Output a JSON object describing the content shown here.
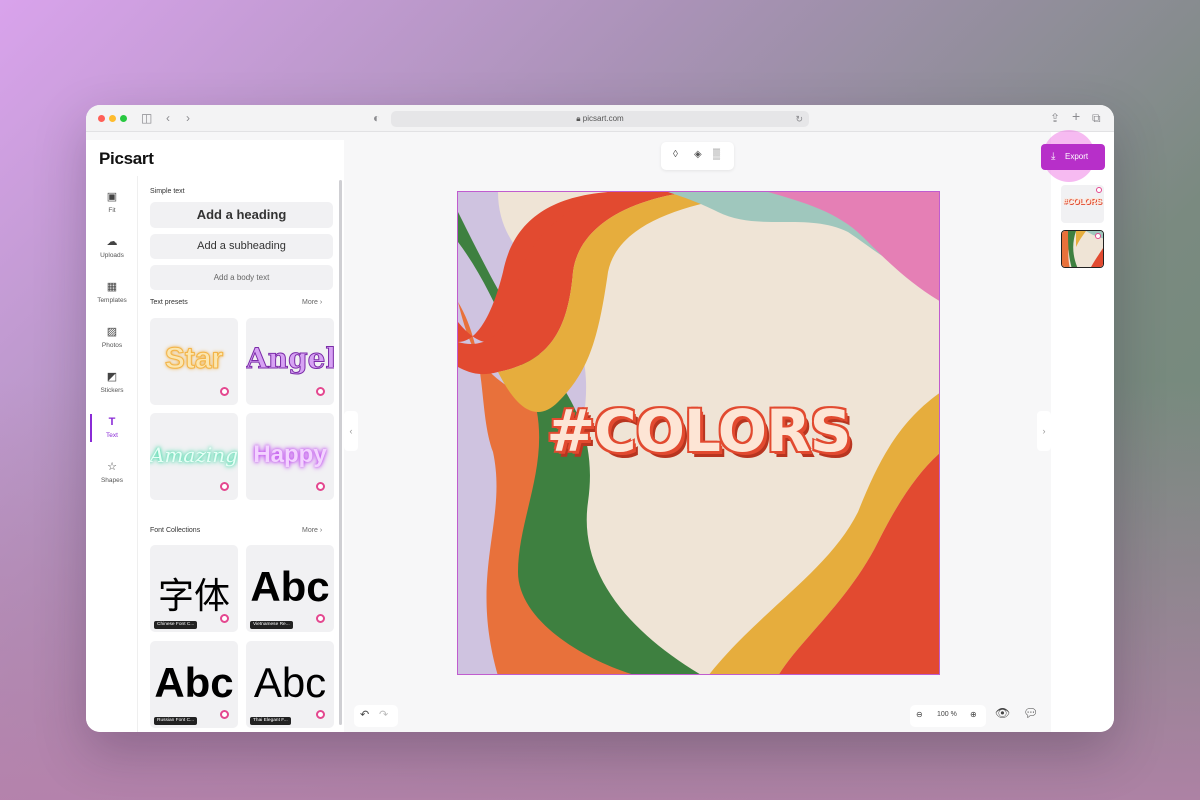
{
  "browser": {
    "url": "picsart.com",
    "reload_icon": "reload-icon"
  },
  "app": {
    "logo": "Picsart"
  },
  "rail": [
    {
      "label": "Fit",
      "icon": "▣"
    },
    {
      "label": "Uploads",
      "icon": "☁"
    },
    {
      "label": "Templates",
      "icon": "▦"
    },
    {
      "label": "Photos",
      "icon": "▨"
    },
    {
      "label": "Stickers",
      "icon": "◩"
    },
    {
      "label": "Text",
      "icon": "T",
      "active": true
    },
    {
      "label": "Shapes",
      "icon": "☆"
    }
  ],
  "panel": {
    "simple_text_label": "Simple text",
    "heading_btn": "Add a heading",
    "subheading_btn": "Add a subheading",
    "body_btn": "Add a body text",
    "presets_label": "Text presets",
    "presets_more": "More",
    "presets": [
      "Star",
      "Angel",
      "Amazing",
      "Happy"
    ],
    "fonts_label": "Font Collections",
    "fonts_more": "More",
    "fonts": [
      {
        "sample": "字体",
        "caption": "Chinese Font C..."
      },
      {
        "sample": "Abc",
        "caption": "Vietnamese Re..."
      },
      {
        "sample": "Abc",
        "caption": "Russian Font C..."
      },
      {
        "sample": "Abc",
        "caption": "Thai Elegant F..."
      }
    ]
  },
  "toolbar": {
    "export_label": "Export"
  },
  "canvas": {
    "text": "#COLORS"
  },
  "zoom": {
    "value": "100 %"
  },
  "colors": {
    "accent": "#b72fc9",
    "canvas_bg": "#efe4d6",
    "orange": "#e8713b",
    "red": "#e24a30",
    "yellow": "#e6ad3d",
    "green": "#3e8040",
    "lavender": "#cfc3e0",
    "mint": "#9fc7bd",
    "pink": "#e57fb5"
  }
}
